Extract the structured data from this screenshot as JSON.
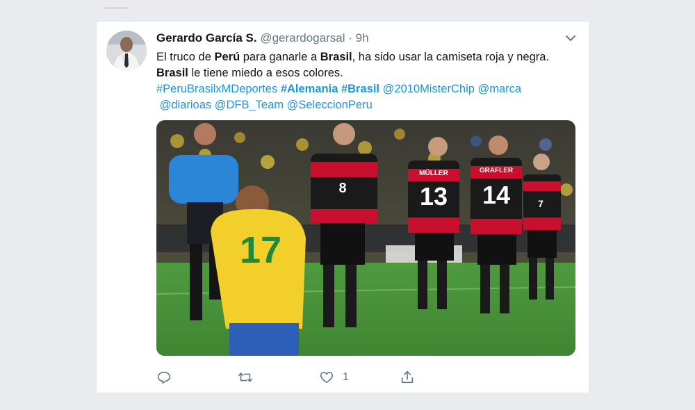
{
  "tweet": {
    "display_name": "Gerardo García S.",
    "handle": "@gerardogarsal",
    "separator": "·",
    "time": "9h",
    "line1": {
      "t1": "El truco de ",
      "b1": "Perú",
      "t2": " para ganarle a ",
      "b2": "Brasil",
      "t3": ", ha sido usar la camiseta roja y negra."
    },
    "line2": {
      "b1": "Brasil",
      "t1": " le tiene miedo a esos colores."
    },
    "tags_line1": {
      "h1": "#PeruBrasilxMDeportes",
      "h2": "#Alemania",
      "h3": "#Brasil",
      "m1": "@2010MisterChip",
      "m2": "@marca"
    },
    "tags_line2": {
      "m3": "@diarioas",
      "m4": "@DFB_Team",
      "m5": "@SeleccionPeru"
    },
    "media": {
      "jersey_numbers": [
        "17",
        "8",
        "13",
        "14",
        "7"
      ],
      "jersey_names": [
        "MÜLLER",
        "GRAFLER"
      ]
    },
    "actions": {
      "like_count": "1"
    },
    "icons": [
      "reply-icon",
      "retweet-icon",
      "like-icon",
      "share-icon",
      "chevron-down-icon"
    ],
    "colors": {
      "link": "#1b95e0",
      "secondary": "#657786",
      "brazil_yellow": "#f2cf2a",
      "germany_red": "#c8102e"
    }
  }
}
